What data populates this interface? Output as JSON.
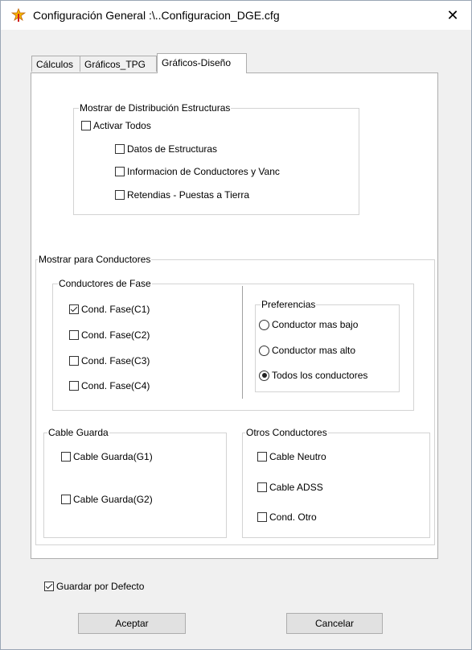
{
  "window": {
    "title": "Configuración General :\\..Configuracion_DGE.cfg",
    "close_glyph": "✕"
  },
  "tabs": [
    {
      "label": "Cálculos",
      "active": false
    },
    {
      "label": "Gráficos_TPG",
      "active": false
    },
    {
      "label": "Gráficos-Diseño",
      "active": true
    }
  ],
  "distribucion": {
    "title": "Mostrar de Distribución Estructuras",
    "activar_todos": {
      "label": "Activar Todos",
      "checked": false
    },
    "items": [
      {
        "label": "Datos de Estructuras",
        "checked": false
      },
      {
        "label": "Informacion de Conductores y Vanc",
        "checked": false
      },
      {
        "label": "Retendias - Puestas a Tierra",
        "checked": false
      }
    ]
  },
  "conductores": {
    "title": "Mostrar para Conductores",
    "fase": {
      "title": "Conductores de Fase",
      "items": [
        {
          "label": "Cond. Fase(C1)",
          "checked": true
        },
        {
          "label": "Cond. Fase(C2)",
          "checked": false
        },
        {
          "label": "Cond. Fase(C3)",
          "checked": false
        },
        {
          "label": "Cond. Fase(C4)",
          "checked": false
        }
      ]
    },
    "preferencias": {
      "title": "Preferencias",
      "options": [
        {
          "label": "Conductor mas bajo",
          "selected": false
        },
        {
          "label": "Conductor mas alto",
          "selected": false
        },
        {
          "label": "Todos los conductores",
          "selected": true
        }
      ]
    },
    "guarda": {
      "title": "Cable Guarda",
      "items": [
        {
          "label": "Cable Guarda(G1)",
          "checked": false
        },
        {
          "label": "Cable Guarda(G2)",
          "checked": false
        }
      ]
    },
    "otros": {
      "title": "Otros Conductores",
      "items": [
        {
          "label": "Cable Neutro",
          "checked": false
        },
        {
          "label": "Cable ADSS",
          "checked": false
        },
        {
          "label": "Cond. Otro",
          "checked": false
        }
      ]
    }
  },
  "guardar_defecto": {
    "label": "Guardar por Defecto",
    "checked": true
  },
  "buttons": {
    "accept": "Aceptar",
    "cancel": "Cancelar"
  },
  "colors": {
    "title_bg": "#ffffff",
    "dialog_bg": "#f0f0f0",
    "panel_bg": "#ffffff",
    "group_border": "#d3d3d3"
  }
}
